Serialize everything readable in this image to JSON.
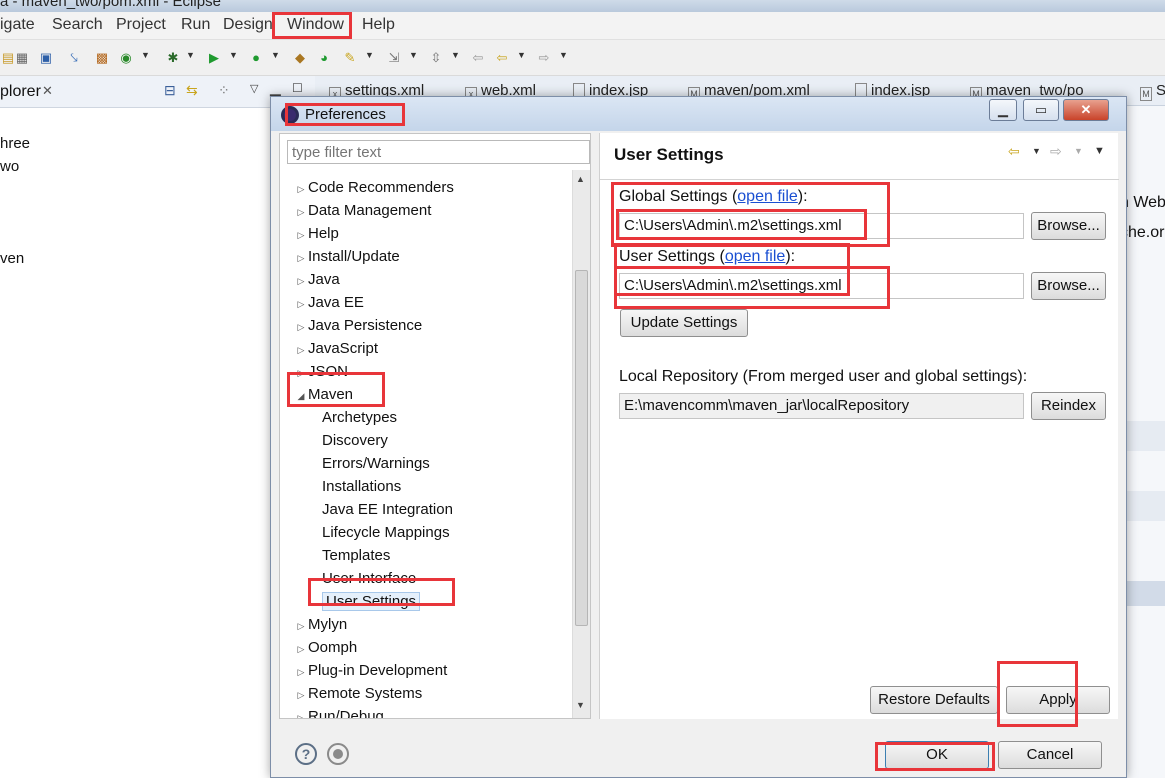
{
  "window": {
    "title": "a - maven_two/pom.xml - Eclipse",
    "menu": [
      "igate",
      "Search",
      "Project",
      "Run",
      "Design",
      "Window",
      "Help"
    ]
  },
  "explorer": {
    "title": "plorer",
    "tree_fragments": [
      "hree",
      "wo",
      "ven"
    ]
  },
  "editor_tabs": [
    "settings.xml",
    "web.xml",
    "index.jsp",
    "maven/pom.xml",
    "index.jsp",
    "maven_two/po",
    "S"
  ],
  "right_fragments": [
    "n Web",
    "che.or"
  ],
  "dialog": {
    "title": "Preferences",
    "filter_placeholder": "type filter text",
    "tree": [
      {
        "label": "Code Recommenders"
      },
      {
        "label": "Data Management"
      },
      {
        "label": "Help"
      },
      {
        "label": "Install/Update"
      },
      {
        "label": "Java"
      },
      {
        "label": "Java EE"
      },
      {
        "label": "Java Persistence"
      },
      {
        "label": "JavaScript"
      },
      {
        "label": "JSON"
      },
      {
        "label": "Maven",
        "expanded": true
      },
      {
        "label": "Archetypes",
        "child": true
      },
      {
        "label": "Discovery",
        "child": true
      },
      {
        "label": "Errors/Warnings",
        "child": true
      },
      {
        "label": "Installations",
        "child": true
      },
      {
        "label": "Java EE Integration",
        "child": true
      },
      {
        "label": "Lifecycle Mappings",
        "child": true
      },
      {
        "label": "Templates",
        "child": true
      },
      {
        "label": "User Interface",
        "child": true
      },
      {
        "label": "User Settings",
        "child": true,
        "selected": true
      },
      {
        "label": "Mylyn"
      },
      {
        "label": "Oomph"
      },
      {
        "label": "Plug-in Development"
      },
      {
        "label": "Remote Systems"
      },
      {
        "label": "Run/Debug"
      }
    ],
    "page": {
      "heading": "User Settings",
      "global_label": "Global Settings (",
      "global_link": "open file",
      "global_suffix": "):",
      "global_value": "C:\\Users\\Admin\\.m2\\settings.xml",
      "user_label": "User Settings (",
      "user_link": "open file",
      "user_suffix": "):",
      "user_value": "C:\\Users\\Admin\\.m2\\settings.xml",
      "browse": "Browse...",
      "update_settings": "Update Settings",
      "local_repo_label": "Local Repository (From merged user and global settings):",
      "local_repo_value": "E:\\mavencomm\\maven_jar\\localRepository",
      "reindex": "Reindex"
    },
    "buttons": {
      "restore_defaults": "Restore Defaults",
      "apply": "Apply",
      "ok": "OK",
      "cancel": "Cancel"
    },
    "colors": {
      "highlight": "#e8353a",
      "link": "#1a4fd2",
      "selection": "#e5f0fb"
    }
  }
}
